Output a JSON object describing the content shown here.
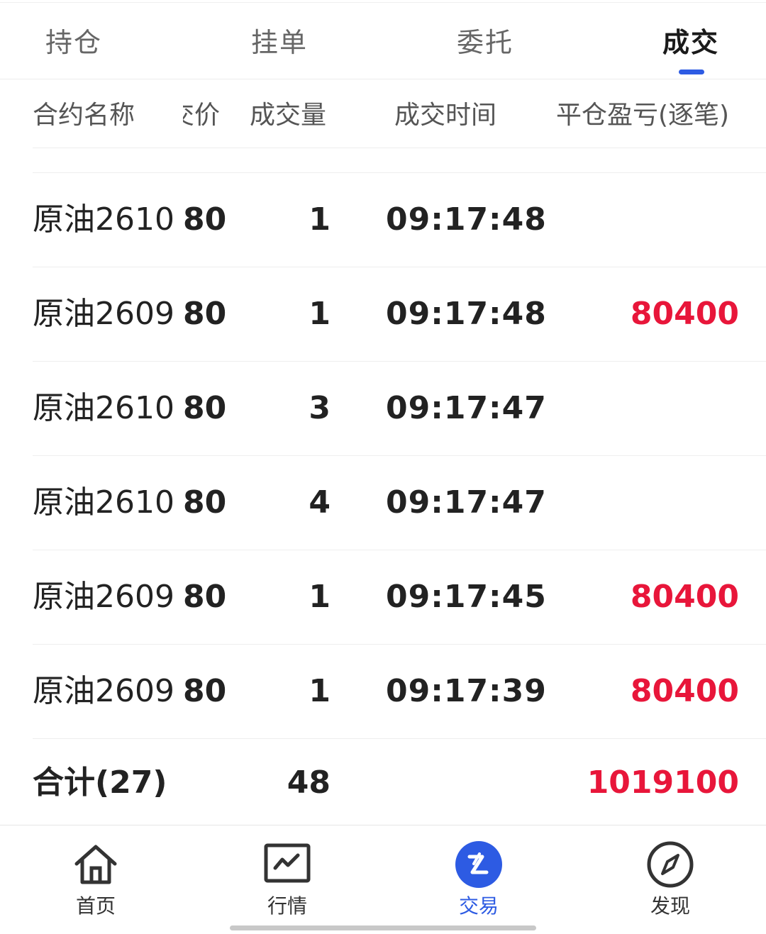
{
  "tabs": [
    {
      "label": "持仓"
    },
    {
      "label": "挂单"
    },
    {
      "label": "委托"
    },
    {
      "label": "成交"
    }
  ],
  "active_tab": "成交",
  "columns": {
    "name": "合约名称",
    "price": "成交价",
    "qty": "成交量",
    "time": "成交时间",
    "pnl": "平仓盈亏(逐笔)"
  },
  "rows": [
    {
      "name": "原油2610",
      "price": "80",
      "qty": "1",
      "time": "09:17:48",
      "pnl": ""
    },
    {
      "name": "原油2609",
      "price": "80",
      "qty": "1",
      "time": "09:17:48",
      "pnl": "80400"
    },
    {
      "name": "原油2610",
      "price": "80",
      "qty": "3",
      "time": "09:17:47",
      "pnl": ""
    },
    {
      "name": "原油2610",
      "price": "80",
      "qty": "4",
      "time": "09:17:47",
      "pnl": ""
    },
    {
      "name": "原油2609",
      "price": "80",
      "qty": "1",
      "time": "09:17:45",
      "pnl": "80400"
    },
    {
      "name": "原油2609",
      "price": "80",
      "qty": "1",
      "time": "09:17:39",
      "pnl": "80400"
    }
  ],
  "total": {
    "label": "合计(27)",
    "qty": "48",
    "pnl": "1019100"
  },
  "bottom_nav": [
    {
      "label": "首页",
      "icon": "home-icon"
    },
    {
      "label": "行情",
      "icon": "chart-icon"
    },
    {
      "label": "交易",
      "icon": "trade-icon"
    },
    {
      "label": "发现",
      "icon": "compass-icon"
    }
  ],
  "colors": {
    "accent": "#2d5be3",
    "loss_profit_red": "#e8163a"
  }
}
